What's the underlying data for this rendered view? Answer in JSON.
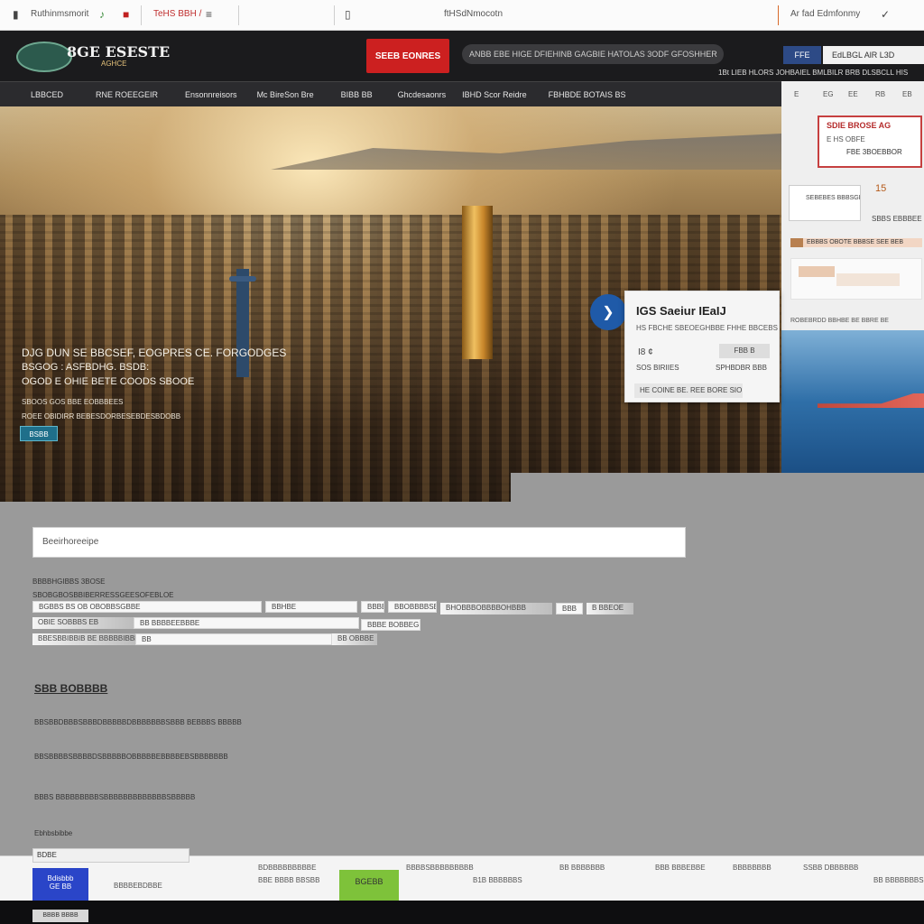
{
  "browser": {
    "left_text": "Ruthinmsmorit",
    "tab_text": "TeHS BBH /",
    "url": "ftHSdNmocotn",
    "right_text": "Ar fad Edmfonmy"
  },
  "header": {
    "logo_text": "8GE ESESTE",
    "logo_sub": "AGHCE",
    "cta_label": "SEEB EONRES",
    "tagline": "ANBB EBE HIGE DFIEHINB GAGBIE HATOLAS 3ODF GFOSHHER",
    "lang_label": "FFE",
    "login_label": "EdLBGL   AlR L3D",
    "links": "1Bt LIEB HLORS JOHBAIEL BMLBILR  BRB DLSBCLL HIS"
  },
  "nav": {
    "items": [
      "LBBCED",
      "RNE ROEEGEIR",
      "Ensonnreisors",
      "Mc BireSon Bre",
      "BIBB BB",
      "Ghcdesaonrs",
      "IBHD Scor Reidre",
      "FBHBDE BOTAIS BS"
    ]
  },
  "hero": {
    "headline": "DJG DUN SE BBCSEF, EOGPRES CE. FORGODGES",
    "subline": "BSGOG : ASFBDHG. BSDB:",
    "third": "OGOD E OHIE BETE COODS SBOOE",
    "small1": "SBOOS GOS BBE EOBBBEES",
    "small2": "ROEE OBIDIRR BEBESDORBESEBDESBDOBB",
    "button": "BSBB"
  },
  "popup": {
    "title": "IGS Saeiur IEaIJ",
    "subtitle": "HS FBCHE SBEOEGHBBE FHHE BBCEBS",
    "num": "I8  ¢",
    "btn": "FBB B",
    "left": "SOS BIRIIES",
    "right": "SPHBDBR BBB",
    "footer": "HE COINE BE. REE BORE SIORE"
  },
  "sidebar": {
    "top_items": [
      "E",
      "EG",
      "EE",
      "RB",
      "EB"
    ],
    "red_title": "SDIE BROSE AG",
    "red_sub": "E HS OBFE",
    "red_val": "FBE 3BOEBBOR",
    "card_text": "SEBEBES BBBSGE",
    "num": "15",
    "num_label": "SBBS EBBBEE",
    "bar_text": "EBBBS  OBOTE BBBSE SEE BEB",
    "water_caption": "ROBEBRDD BBHBE  BE BBRE BE"
  },
  "content": {
    "search_placeholder": "Beeirhoreeipe",
    "filter_title": "BBBBHGIBBS 3BOSE",
    "filter_sub": "SBOBGBOSBBIBERRESSGEESOFEBLOE",
    "chips_row1": [
      "BGBBS BS OB OBOBBSGBBE",
      "BBHBE",
      "BBBE",
      "BBOBBBBSBHBE",
      "BHOBBBOBBBBOHBBB",
      "BBB",
      "B BBEOE"
    ],
    "chips_row2": [
      "OBIE  SOBBBS  EB",
      "BB BBBBEEBBBE",
      "BBBE  BOBBEGE"
    ],
    "chips_row3": [
      "BBESBBIBBIB BE BBBBBIBBE",
      "BB",
      "BB OBBBE"
    ],
    "section_heading": "SBB BOBBBB",
    "lines": [
      "BBSBBDBBBSBBBDBBBBBDBBBBBBBSBBB BEBBBS   BBBBB",
      "BBSBBBBSBBBBDSBBBBBOBBBBBEBBBBEBSBBBBBBB",
      "BBBS BBBBBBBBBSBBBBBBBBBBBBBSBBBBB",
      "Ebhbsbibbe"
    ]
  },
  "footer": {
    "left_tab": "BDBE",
    "blue_label": "Bdisbbb\nGE BB",
    "blue_sub": "BBBBEBDBBE",
    "green_label": "BGEBB",
    "items": [
      "BDBBBBBBBBBE",
      "BBE BBBB BBSBB",
      "BBBBSBBBBBBBBB",
      "B1B BBBBBBS",
      "BB BBBBBBB",
      "BBB BBBEBBE",
      "BBBBBBBB",
      "SSBB DBBBBBB",
      "BB BBBBBBBS"
    ],
    "thumb_label": "BBBB BBBB"
  }
}
